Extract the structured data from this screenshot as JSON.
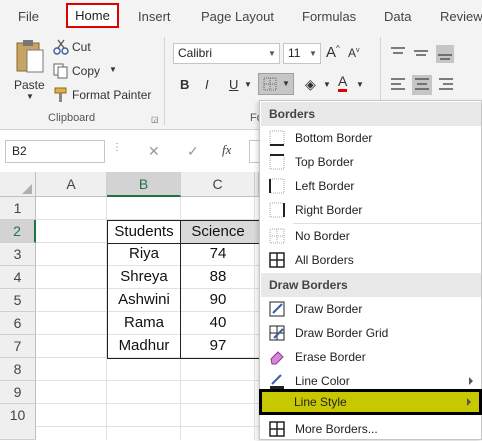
{
  "tabs": [
    "File",
    "Home",
    "Insert",
    "Page Layout",
    "Formulas",
    "Data",
    "Review"
  ],
  "clipboard": {
    "paste": "Paste",
    "cut": "Cut",
    "copy": "Copy",
    "format_painter": "Format Painter",
    "group_label": "Clipboard"
  },
  "font": {
    "name": "Calibri",
    "size": "11",
    "bold": "B",
    "italic": "I",
    "group_label_partial": "Fo"
  },
  "formula_bar": {
    "name_box": "B2",
    "fx": "fx"
  },
  "columns": [
    "A",
    "B",
    "C"
  ],
  "rows": [
    "1",
    "2",
    "3",
    "4",
    "5",
    "6",
    "7",
    "8",
    "9",
    "10"
  ],
  "table": {
    "headers": [
      "Students",
      "Science"
    ],
    "rows": [
      [
        "Riya",
        "74"
      ],
      [
        "Shreya",
        "88"
      ],
      [
        "Ashwini",
        "90"
      ],
      [
        "Rama",
        "40"
      ],
      [
        "Madhur",
        "97"
      ]
    ]
  },
  "menu": {
    "borders_header": "Borders",
    "draw_header": "Draw Borders",
    "items": {
      "bottom": "Bottom Border",
      "top": "Top Border",
      "left": "Left Border",
      "right": "Right Border",
      "no": "No Border",
      "all": "All Borders",
      "draw": "Draw Border",
      "draw_grid": "Draw Border Grid",
      "erase": "Erase Border",
      "line_color": "Line Color",
      "line_style": "Line Style",
      "more": "More Borders..."
    }
  },
  "colors": {
    "highlight": "#c8c800",
    "home_outline": "#e00000",
    "selected_header": "#d3d3d3"
  }
}
